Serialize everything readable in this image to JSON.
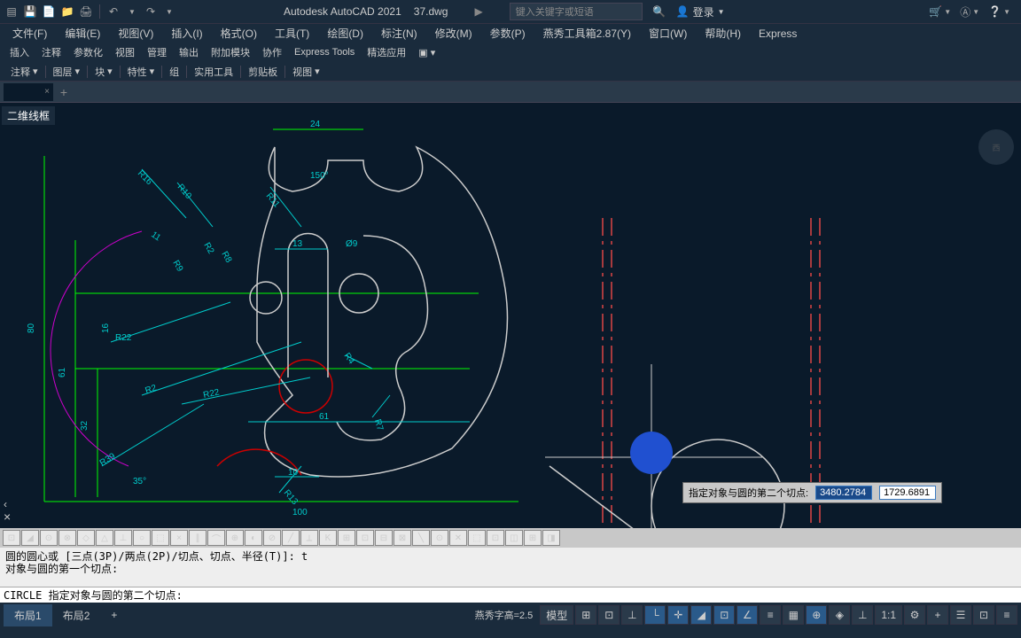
{
  "app": {
    "name": "Autodesk AutoCAD 2021",
    "file": "37.dwg"
  },
  "search": {
    "placeholder": "键入关键字或短语"
  },
  "login": {
    "label": "登录"
  },
  "menubar": [
    "文件(F)",
    "编辑(E)",
    "视图(V)",
    "插入(I)",
    "格式(O)",
    "工具(T)",
    "绘图(D)",
    "标注(N)",
    "修改(M)",
    "参数(P)",
    "燕秀工具箱2.87(Y)",
    "窗口(W)",
    "帮助(H)",
    "Express"
  ],
  "panels": [
    "插入",
    "注释",
    "参数化",
    "视图",
    "管理",
    "输出",
    "附加模块",
    "协作",
    "Express Tools",
    "精选应用"
  ],
  "toolgroups": [
    "注释",
    "图层",
    "块",
    "特性",
    "组",
    "实用工具",
    "剪贴板",
    "视图"
  ],
  "workspace": "二维线框",
  "cmd": {
    "line1": "圆的圆心或 [三点(3P)/两点(2P)/切点、切点、半径(T)]: t",
    "line2": "对象与圆的第一个切点:",
    "prompt": "CIRCLE 指定对象与圆的第二个切点:"
  },
  "tooltip": {
    "label": "指定对象与圆的第二个切点:",
    "val1": "3480.2784",
    "val2": "1729.6891"
  },
  "layouts": {
    "l1": "布局1",
    "l2": "布局2"
  },
  "status": {
    "yanxiu": "燕秀字高=2.5",
    "model": "模型",
    "scale": "1:1"
  },
  "dims": {
    "d24": "24",
    "d150": "150°",
    "d80": "80",
    "d61": "61",
    "d32": "32",
    "d16": "16",
    "d100": "100",
    "d61b": "61",
    "d13": "13",
    "d10": "10",
    "d11": "11",
    "d35": "35°",
    "r16": "R16",
    "r10": "R10",
    "r11": "R11",
    "r22": "R22",
    "r22b": "R22",
    "r39": "R39",
    "r13": "R13",
    "r2": "R2",
    "r8": "R8",
    "r9": "R9",
    "r2b": "R2",
    "r4": "R4",
    "r7": "R7",
    "o9": "Ø9"
  },
  "navcube": "西"
}
